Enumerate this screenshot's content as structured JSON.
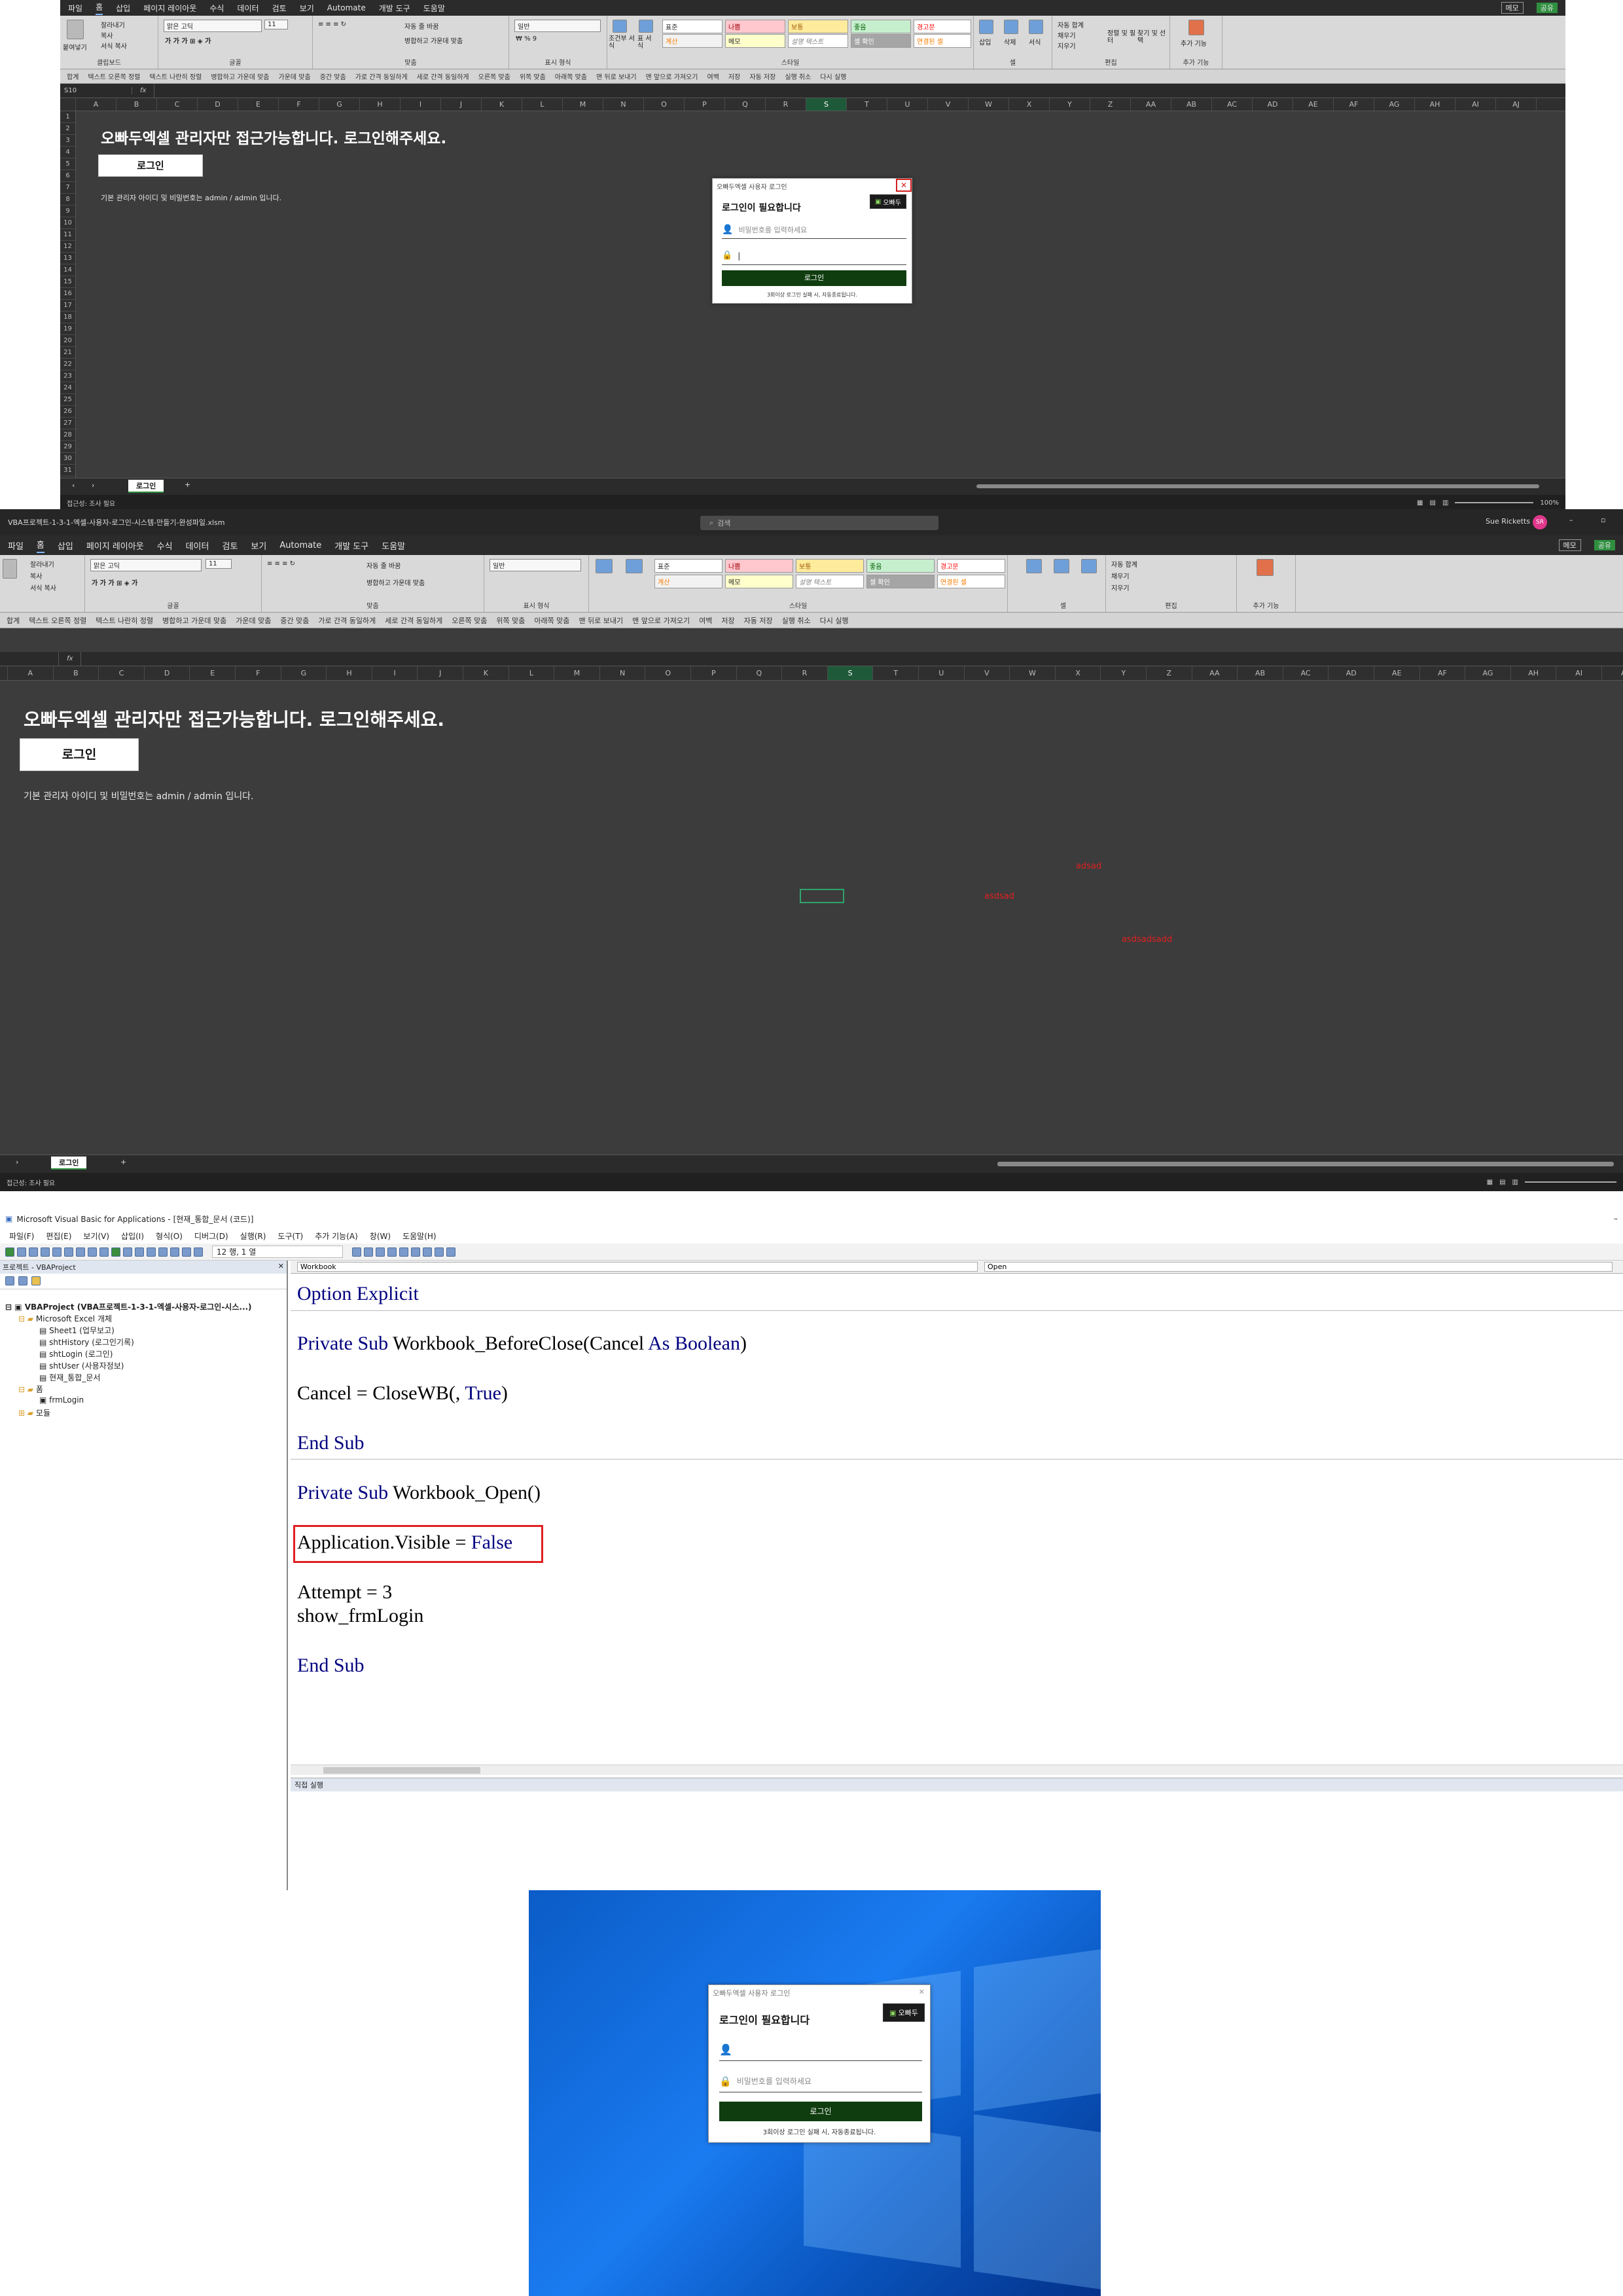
{
  "excel_top": {
    "menu": [
      "파일",
      "홈",
      "삽입",
      "페이지 레이아웃",
      "수식",
      "데이터",
      "검토",
      "보기",
      "Automate",
      "개발 도구",
      "도움말"
    ],
    "menu_right": [
      "메모",
      "공유"
    ],
    "ribbon": {
      "clipboard": {
        "label": "클립보드",
        "paste": "붙여넣기",
        "cut": "잘라내기",
        "copy": "복사",
        "format_painter": "서식 복사"
      },
      "font": {
        "label": "글꼴",
        "name": "맑은 고딕",
        "size": "11"
      },
      "align": {
        "label": "맞춤",
        "wrap": "자동 줄 바꿈",
        "merge": "병합하고 가운데 맞춤"
      },
      "number": {
        "label": "표시 형식",
        "format": "일반"
      },
      "styles": {
        "label": "스타일",
        "cond": "조건부 서식",
        "table": "표 서식",
        "cells": [
          "표준",
          "나쁨",
          "보통",
          "좋음",
          "경고문",
          "계산",
          "메모",
          "설명 텍스트",
          "셀 확인",
          "연결된 셀"
        ]
      },
      "cells_group": {
        "label": "셀",
        "insert": "삽입",
        "delete": "삭제",
        "format": "서식"
      },
      "edit": {
        "label": "편집",
        "autosum": "자동 합계",
        "fill": "채우기",
        "clear": "지우기",
        "sort": "정렬 및 필터",
        "find": "찾기 및 선택"
      },
      "addin": {
        "label": "추가 기능",
        "name": "추가 기능"
      }
    },
    "qat": [
      "합계",
      "텍스트 오른쪽 정렬",
      "텍스트 나란히 정렬",
      "병합하고 가운데 맞춤",
      "가운데 맞춤",
      "중간 맞춤",
      "가로 간격 동일하게",
      "세로 간격 동일하게",
      "오른쪽 맞춤",
      "위쪽 맞춤",
      "아래쪽 맞춤",
      "맨 뒤로 보내기",
      "맨 앞으로 가져오기",
      "여백",
      "저장",
      "자동 저장",
      "실행 취소",
      "다시 실행"
    ],
    "name_box": "S10",
    "fx": "fx",
    "columns": [
      "A",
      "B",
      "C",
      "D",
      "E",
      "F",
      "G",
      "H",
      "I",
      "J",
      "K",
      "L",
      "M",
      "N",
      "O",
      "P",
      "Q",
      "R",
      "S",
      "T",
      "U",
      "V",
      "W",
      "X",
      "Y",
      "Z",
      "AA",
      "AB",
      "AC",
      "AD",
      "AE",
      "AF",
      "AG",
      "AH",
      "AI",
      "AJ"
    ],
    "rows": [
      "1",
      "2",
      "3",
      "4",
      "5",
      "6",
      "7",
      "8",
      "9",
      "10",
      "11",
      "12",
      "13",
      "14",
      "15",
      "16",
      "17",
      "18",
      "19",
      "20",
      "21",
      "22",
      "23",
      "24",
      "25",
      "26",
      "27",
      "28",
      "29",
      "30",
      "31"
    ],
    "heading": "오빠두엑셀 관리자만 접근가능합니다. 로그인해주세요.",
    "login_button": "로그인",
    "note": "기본 관리자 아이디 및 비밀번호는 admin / admin 입니다.",
    "sheet_tab": "로그인",
    "status": "접근성: 조사 필요",
    "zoom": "100%"
  },
  "dialog_top": {
    "title": "오빠두엑셀 사용자 로그인",
    "heading": "로그인이 필요합니다",
    "logo": "오빠두",
    "id_placeholder": "비밀번호를 입력하세요",
    "pw_value": "|",
    "button": "로그인",
    "message": "3회이상 로그인 실패 시, 자동종료됩니다.",
    "close": "✕"
  },
  "excel_mid": {
    "title": "VBA프로젝트-1-3-1-엑셀-사용자-로그인-시스템-만들기-완성파일.xlsm",
    "search": "검색",
    "user": "Sue Ricketts",
    "avatar": "SR",
    "annotations": [
      "adsad",
      "asdsad",
      "asdsadsadd"
    ],
    "status": "접근성: 조사 필요"
  },
  "vbe": {
    "title": "Microsoft Visual Basic for Applications - [현재_통합_문서 (코드)]",
    "menu": [
      "파일(F)",
      "편집(E)",
      "보기(V)",
      "삽입(I)",
      "형식(O)",
      "디버그(D)",
      "실행(R)",
      "도구(T)",
      "추가 기능(A)",
      "창(W)",
      "도움말(H)"
    ],
    "position": "12 행, 1 열",
    "project_label": "프로젝트 - VBAProject",
    "tree": [
      "VBAProject (VBA프로젝트-1-3-1-엑셀-사용자-로그인-시스...)",
      "Microsoft Excel 개체",
      "Sheet1 (업무보고)",
      "shtHistory (로그인기록)",
      "shtLogin (로그인)",
      "shtUser (사용자정보)",
      "현재_통합_문서",
      "폼",
      "frmLogin",
      "모듈"
    ],
    "object_combo": "Workbook",
    "proc_combo": "Open",
    "code": {
      "l1_kw": "Option Explicit",
      "l2_kw": "Private Sub",
      "l2_name": " Workbook_BeforeClose(Cancel ",
      "l2_as": "As Boolean",
      "l2_end": ")",
      "l3_a": "Cancel = CloseWB(, ",
      "l3_kw": "True",
      "l3_b": ")",
      "l4_kw": "End Sub",
      "l5_kw": "Private Sub",
      "l5_name": " Workbook_Open()",
      "l6_a": "Application.Visible = ",
      "l6_kw": "False",
      "l7": "Attempt = 3",
      "l8": "show_frmLogin",
      "l9_kw": "End Sub"
    },
    "immediate_label": "직접 실행",
    "highlight_color": "#e02020"
  },
  "dialog_bottom": {
    "title": "오빠두엑셀 사용자 로그인",
    "heading": "로그인이 필요합니다",
    "logo": "오빠두",
    "pw_placeholder": "비밀번호를 입력하세요",
    "button": "로그인",
    "message": "3회이상 로그인 실패 시, 자동종료됩니다.",
    "close": "✕"
  },
  "colors": {
    "excel_bg": "#3c3c3c",
    "login_green": "#0f3d0f",
    "vba_keyword": "#00007f",
    "desktop_blue": "#1a7bf0"
  }
}
